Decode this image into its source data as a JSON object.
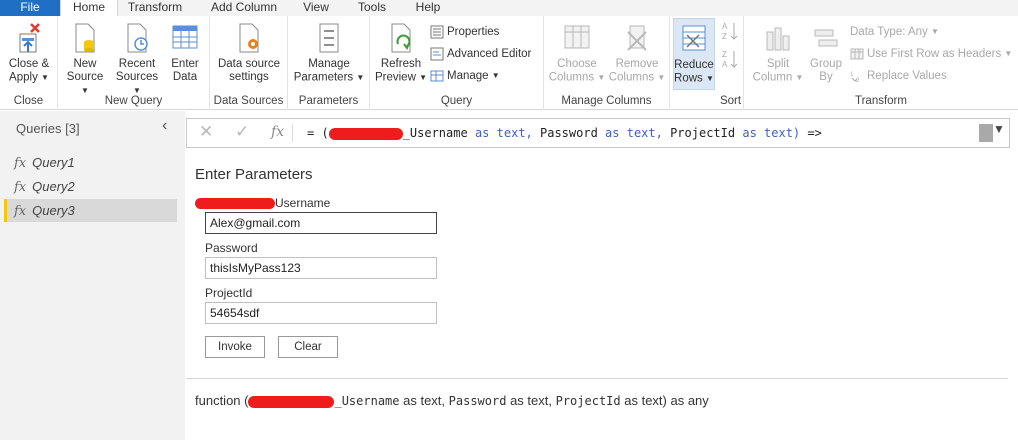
{
  "menu": {
    "items": [
      "File",
      "Home",
      "Transform",
      "Add Column",
      "View",
      "Tools",
      "Help"
    ]
  },
  "ribbon": {
    "close_group": {
      "label": "Close",
      "close_apply": "Close &",
      "close_apply_2": "Apply"
    },
    "new_query_group": {
      "label": "New Query",
      "new_source": "New",
      "new_source_2": "Source",
      "recent_sources": "Recent",
      "recent_sources_2": "Sources",
      "enter_data": "Enter",
      "enter_data_2": "Data"
    },
    "data_sources_group": {
      "label": "Data Sources",
      "settings": "Data source",
      "settings_2": "settings"
    },
    "parameters_group": {
      "label": "Parameters",
      "manage": "Manage",
      "manage_2": "Parameters"
    },
    "query_group": {
      "label": "Query",
      "refresh": "Refresh",
      "refresh_2": "Preview",
      "properties": "Properties",
      "advanced_editor": "Advanced Editor",
      "manage": "Manage"
    },
    "manage_columns_group": {
      "label": "Manage Columns",
      "choose": "Choose",
      "choose_2": "Columns",
      "remove": "Remove",
      "remove_2": "Columns"
    },
    "reduce_rows": {
      "label": "Reduce",
      "label_2": "Rows"
    },
    "sort_group": {
      "label": "Sort"
    },
    "transform_group": {
      "label": "Transform",
      "split": "Split",
      "split_2": "Column",
      "group_by": "Group",
      "group_by_2": "By",
      "data_type": "Data Type: Any",
      "first_row": "Use First Row as Headers",
      "replace_values": "Replace Values"
    }
  },
  "queries": {
    "header": "Queries [3]",
    "items": [
      "Query1",
      "Query2",
      "Query3"
    ],
    "active_index": 2
  },
  "formula": {
    "prefix": "= (",
    "p1": "_Username",
    "as1": "as",
    "t1": "text,",
    "p2": "Password",
    "as2": "as",
    "t2": "text,",
    "p3": "ProjectId",
    "as3": "as",
    "t3": "text)",
    "arrow": "=>"
  },
  "params": {
    "title": "Enter Parameters",
    "username_label": "Username",
    "username_value": "Alex@gmail.com",
    "password_label": "Password",
    "password_value": "thisIsMyPass123",
    "project_label": "ProjectId",
    "project_value": "54654sdf",
    "invoke": "Invoke",
    "clear": "Clear"
  },
  "signature": {
    "prefix": "function (",
    "p1": "_Username",
    "mid1": " as text, ",
    "p2": "Password",
    "mid2": " as text, ",
    "p3": "ProjectId",
    "suffix": " as text) as any"
  },
  "colors": {
    "file_menu": "#1f6fc5",
    "redaction": "#ee1c1c",
    "active_query_marker": "#f2c811",
    "keyword": "#3f5fc4"
  }
}
